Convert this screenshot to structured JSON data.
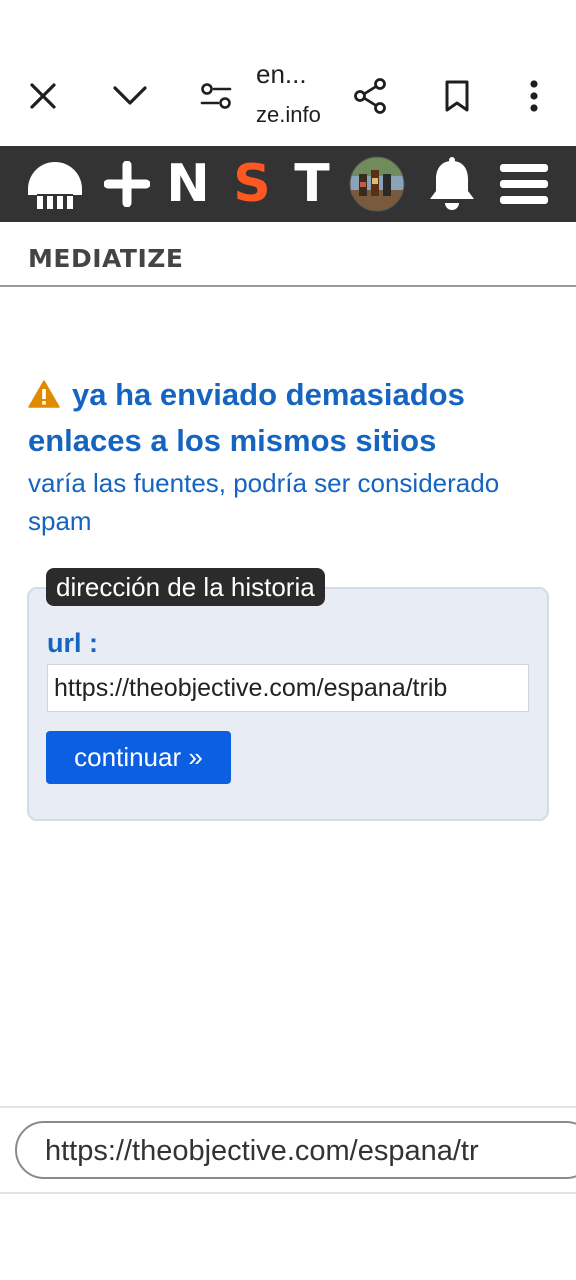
{
  "browser": {
    "tab_title": "en...",
    "domain": "ze.info",
    "icons": [
      "close-icon",
      "chevron-down-icon",
      "page-settings-icon",
      "share-icon",
      "bookmark-icon",
      "more-vert-icon"
    ]
  },
  "nav": {
    "letters": {
      "n": "N",
      "s": "S",
      "t": "T"
    },
    "accent_color": "#ff5722",
    "icons": [
      "mediatize-logo-icon",
      "plus-icon",
      "avatar",
      "bell-icon",
      "menu-icon"
    ]
  },
  "site": {
    "name": "MEDIATIZE"
  },
  "warning": {
    "title": "ya ha enviado demasiados enlaces a los mismos sitios",
    "subtitle": "varía las fuentes, podría ser considerado spam",
    "icon": "warning-icon",
    "color": "#1565c0"
  },
  "form": {
    "legend": "dirección de la historia",
    "url_label": "url :",
    "url_value": "https://theobjective.com/espana/trib",
    "submit_label": "continuar »"
  },
  "bottom": {
    "url_text": "https://theobjective.com/espana/tr"
  }
}
